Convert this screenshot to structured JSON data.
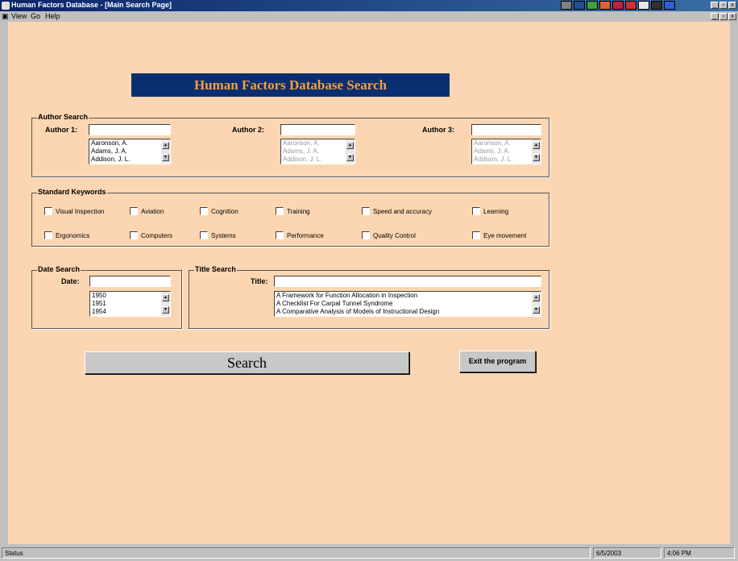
{
  "window": {
    "title": "Human Factors Database - [Main Search Page]"
  },
  "menu": [
    {
      "label": "View"
    },
    {
      "label": "Go"
    },
    {
      "label": "Help"
    }
  ],
  "banner": {
    "title": "Human Factors Database Search"
  },
  "author_search": {
    "legend": "Author Search",
    "author1": {
      "label": "Author 1:",
      "value": "",
      "items": [
        "Aaronson, A.",
        "Adams, J. A.",
        "Addison, J. L."
      ]
    },
    "author2": {
      "label": "Author 2:",
      "value": "",
      "items": [
        "Aaronson, A.",
        "Adams, J. A.",
        "Addison, J. L."
      ]
    },
    "author3": {
      "label": "Author 3:",
      "value": "",
      "items": [
        "Aaronson, A.",
        "Adams, J. A.",
        "Addison, J. L."
      ]
    }
  },
  "keywords": {
    "legend": "Standard Keywords",
    "items": [
      "Visual Inspection",
      "Aviation",
      "Cognition",
      "Training",
      "Speed and accuracy",
      "Learning",
      "Ergonomics",
      "Computers",
      "Systems",
      "Performance",
      "Quality Control",
      "Eye movement"
    ]
  },
  "date_search": {
    "legend": "Date Search",
    "label": "Date:",
    "value": "",
    "items": [
      "1950",
      "1951",
      "1954"
    ]
  },
  "title_search": {
    "legend": "Title Search",
    "label": "Title:",
    "value": "",
    "items": [
      "A  Framework for Function Allocation in Inspection",
      "A Checklist For Carpal Tunnel Syndrome",
      "A Comparative Analysis of Models of Instructional Design"
    ]
  },
  "buttons": {
    "search": "Search",
    "exit": "Exit the program"
  },
  "status": {
    "text": "Status",
    "date": "6/5/2003",
    "time": "4:06 PM"
  },
  "colors": {
    "background": "#fcd6b2",
    "banner_bg": "#0b2e70",
    "banner_text": "#f0a040"
  }
}
